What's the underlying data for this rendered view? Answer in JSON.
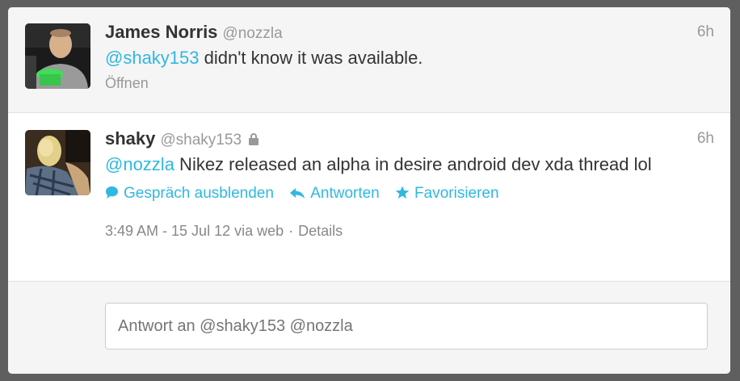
{
  "tweets": [
    {
      "fullname": "James Norris",
      "username": "@nozzla",
      "time": "6h",
      "mention": "@shaky153",
      "text": " didn't know it was available.",
      "expand_label": "Öffnen"
    },
    {
      "fullname": "shaky",
      "username": "@shaky153",
      "time": "6h",
      "mention": "@nozzla",
      "text": " Nikez released an alpha in desire android dev xda thread lol",
      "actions": {
        "hide_conversation": "Gespräch ausblenden",
        "reply": "Antworten",
        "favorite": "Favorisieren"
      },
      "meta": {
        "timestamp": "3:49 AM - 15 Jul 12",
        "via": "via web",
        "separator": "·",
        "details": "Details"
      }
    }
  ],
  "reply_box": {
    "placeholder": "Antwort an @shaky153 @nozzla"
  },
  "colors": {
    "accent": "#2fb8e0",
    "background": "#5f5f5f"
  }
}
